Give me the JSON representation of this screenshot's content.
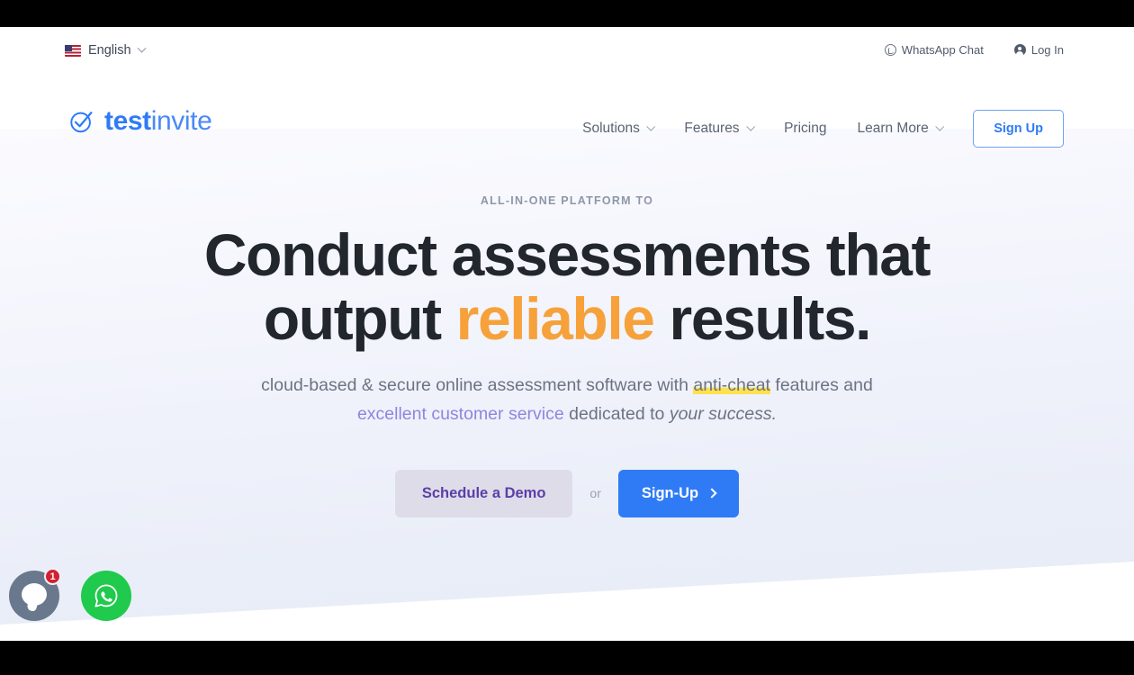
{
  "utility": {
    "language": {
      "label": "English",
      "flag_icon": "us-flag-icon",
      "chevron_icon": "chevron-down-icon"
    },
    "whatsapp_chat": {
      "label": "WhatsApp Chat",
      "icon": "whatsapp-icon"
    },
    "login": {
      "label": "Log In",
      "icon": "user-account-icon"
    }
  },
  "brand": {
    "logo_icon": "check-circle-icon",
    "name_bold": "test",
    "name_light": "invite"
  },
  "nav": {
    "items": [
      {
        "label": "Solutions",
        "has_dropdown": true
      },
      {
        "label": "Features",
        "has_dropdown": true
      },
      {
        "label": "Pricing",
        "has_dropdown": false
      },
      {
        "label": "Learn More",
        "has_dropdown": true
      }
    ],
    "signup_label": "Sign Up"
  },
  "hero": {
    "eyebrow": "ALL-IN-ONE PLATFORM TO",
    "headline_line1": "Conduct assessments that",
    "headline_line2_a": "output ",
    "headline_highlight": "reliable",
    "headline_line2_b": " results.",
    "subtitle_line1_a": "cloud-based & secure online assessment software with ",
    "subtitle_highlight": "anti-cheat",
    "subtitle_line1_b": " features and",
    "subtitle_line2_a": "excellent customer service",
    "subtitle_line2_b": " dedicated to ",
    "subtitle_line2_italic": "your success.",
    "cta_demo": "Schedule a Demo",
    "cta_or": "or",
    "cta_signup": "Sign-Up",
    "cta_signup_icon": "arrow-right-icon"
  },
  "widgets": {
    "chat": {
      "icon": "chat-bubble-icon",
      "badge_count": "1"
    },
    "whatsapp": {
      "icon": "whatsapp-icon"
    }
  },
  "colors": {
    "brand_blue": "#2f7bf6",
    "accent_orange": "#f6a13a",
    "accent_purple": "#8f85e0",
    "highlight_yellow": "#ffe14d",
    "whatsapp_green": "#1fca4c",
    "badge_red": "#d32030"
  }
}
